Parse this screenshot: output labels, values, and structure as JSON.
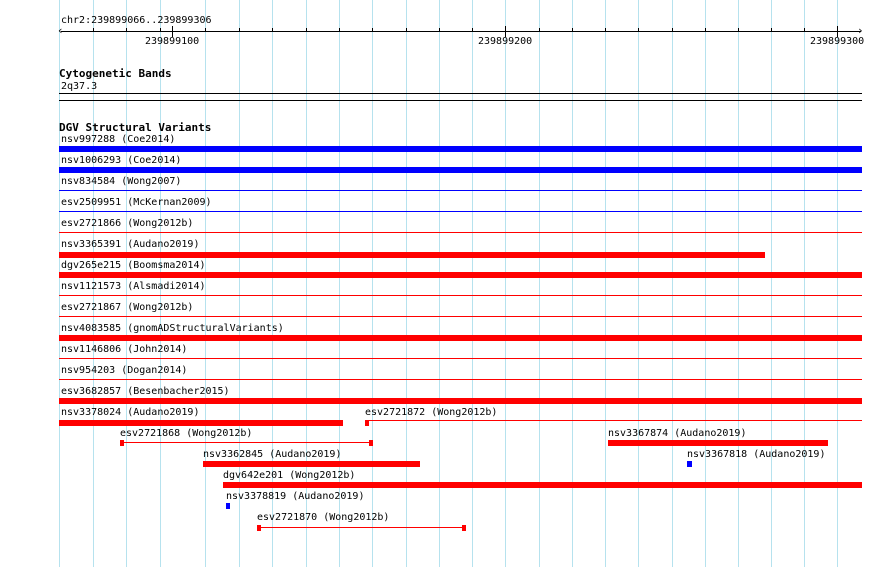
{
  "ruler": {
    "region": "chr2:239899066..239899306",
    "ticks": [
      {
        "label": "239899100",
        "pos": 239899100
      },
      {
        "label": "239899200",
        "pos": 239899200
      },
      {
        "label": "239899300",
        "pos": 239899300
      }
    ]
  },
  "cytoband": {
    "title": "Cytogenetic Bands",
    "band": "2q37.3"
  },
  "dgv": {
    "title": "DGV Structural Variants",
    "colors": {
      "loss": "#ff0000",
      "gain": "#0000ff"
    },
    "variants": [
      {
        "label": "nsv997288 (Coe2014)",
        "type": "gain"
      },
      {
        "label": "nsv1006293 (Coe2014)",
        "type": "gain"
      },
      {
        "label": "nsv834584 (Wong2007)",
        "type": "gain"
      },
      {
        "label": "esv2509951 (McKernan2009)",
        "type": "gain"
      },
      {
        "label": "esv2721866 (Wong2012b)",
        "type": "loss"
      },
      {
        "label": "nsv3365391 (Audano2019)",
        "type": "loss"
      },
      {
        "label": "dgv265e215 (Boomsma2014)",
        "type": "loss"
      },
      {
        "label": "nsv1121573 (Alsmadi2014)",
        "type": "loss"
      },
      {
        "label": "esv2721867 (Wong2012b)",
        "type": "loss"
      },
      {
        "label": "nsv4083585 (gnomADStructuralVariants)",
        "type": "loss"
      },
      {
        "label": "nsv1146806 (John2014)",
        "type": "loss"
      },
      {
        "label": "nsv954203 (Dogan2014)",
        "type": "loss"
      },
      {
        "label": "esv3682857 (Besenbacher2015)",
        "type": "loss"
      },
      {
        "label": "nsv3378024 (Audano2019)",
        "type": "loss"
      },
      {
        "label": "esv2721872 (Wong2012b)",
        "type": "loss"
      },
      {
        "label": "esv2721868 (Wong2012b)",
        "type": "loss"
      },
      {
        "label": "nsv3367874 (Audano2019)",
        "type": "loss"
      },
      {
        "label": "nsv3362845 (Audano2019)",
        "type": "loss"
      },
      {
        "label": "nsv3367818 (Audano2019)",
        "type": "gain"
      },
      {
        "label": "dgv642e201 (Wong2012b)",
        "type": "loss"
      },
      {
        "label": "nsv3378819 (Audano2019)",
        "type": "gain"
      },
      {
        "label": "esv2721870 (Wong2012b)",
        "type": "loss"
      }
    ]
  }
}
